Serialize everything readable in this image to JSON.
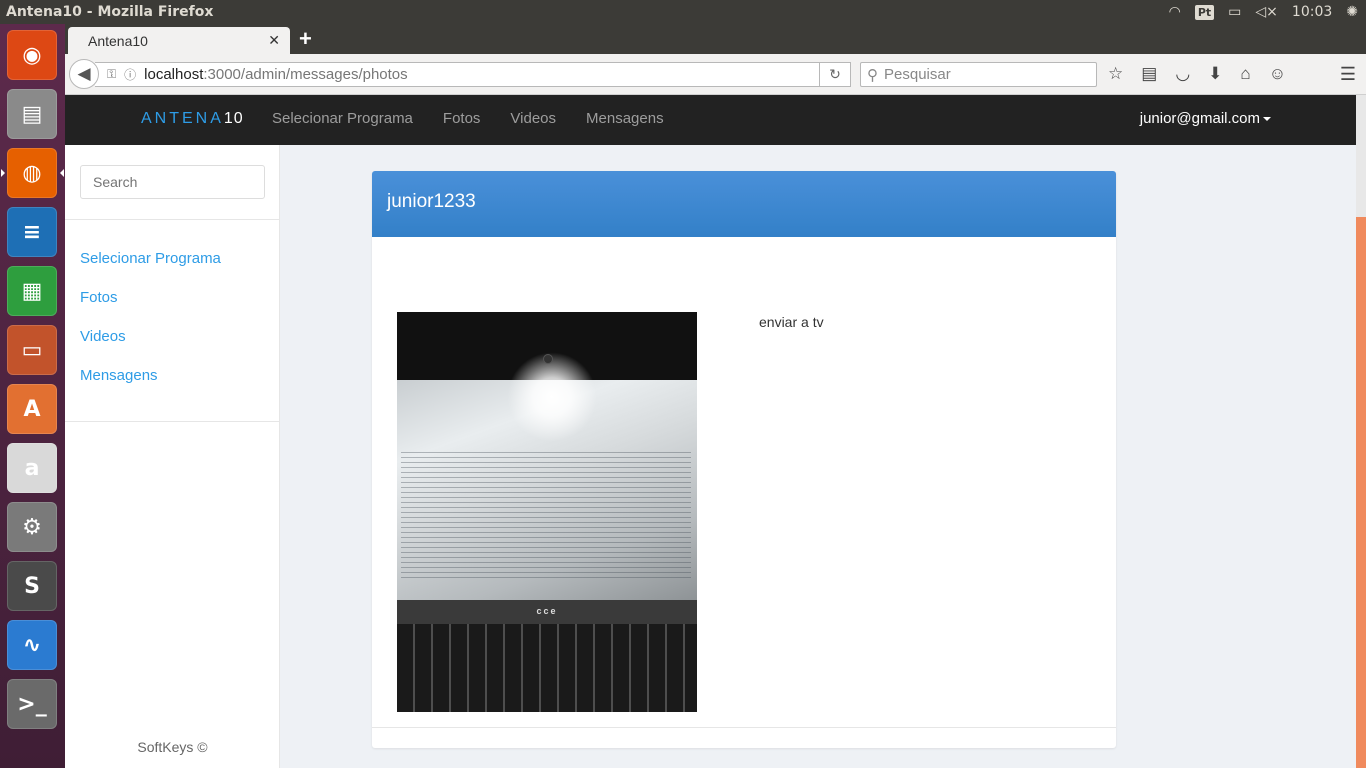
{
  "top_panel": {
    "window_title": "Antena10 - Mozilla Firefox",
    "keyboard_indicator": "Pt",
    "clock": "10:03"
  },
  "launcher": {
    "apps": [
      {
        "name": "ubuntu-dash",
        "glyph": "◉",
        "color": "#dd4814"
      },
      {
        "name": "files",
        "glyph": "▤",
        "color": "#8a8a8a"
      },
      {
        "name": "firefox",
        "glyph": "◍",
        "color": "#e66000"
      },
      {
        "name": "libreoffice-writer",
        "glyph": "≡",
        "color": "#1e6fb5"
      },
      {
        "name": "libreoffice-calc",
        "glyph": "▦",
        "color": "#2e9e3e"
      },
      {
        "name": "libreoffice-impress",
        "glyph": "▭",
        "color": "#c2532b"
      },
      {
        "name": "software-center",
        "glyph": "A",
        "color": "#e27031"
      },
      {
        "name": "amazon",
        "glyph": "a",
        "color": "#d9d9d9"
      },
      {
        "name": "system-settings",
        "glyph": "⚙",
        "color": "#7a7a7a"
      },
      {
        "name": "sublime-text",
        "glyph": "S",
        "color": "#4a4a4a"
      },
      {
        "name": "system-monitor",
        "glyph": "∿",
        "color": "#2b7bd1"
      },
      {
        "name": "terminal",
        "glyph": ">_",
        "color": "#6a6a6a"
      }
    ]
  },
  "browser": {
    "tab_title": "Antena10",
    "url_host": "localhost",
    "url_path": ":3000/admin/messages/photos",
    "search_placeholder": "Pesquisar"
  },
  "app": {
    "brand": "ANTENA",
    "brand_num": "10",
    "nav_links": [
      "Selecionar Programa",
      "Fotos",
      "Videos",
      "Mensagens"
    ],
    "user_email": "junior@gmail.com",
    "sidebar": {
      "search_placeholder": "Search",
      "links": [
        "Selecionar Programa",
        "Fotos",
        "Videos",
        "Mensagens"
      ],
      "footer": "SoftKeys ©"
    },
    "message": {
      "username": "junior1233",
      "action_label": "enviar a tv",
      "photo_brand_text": "cce"
    }
  },
  "colors": {
    "accent_blue": "#2e9ce6",
    "panel_header": "#3a86cf",
    "navbar_bg": "#222222"
  }
}
